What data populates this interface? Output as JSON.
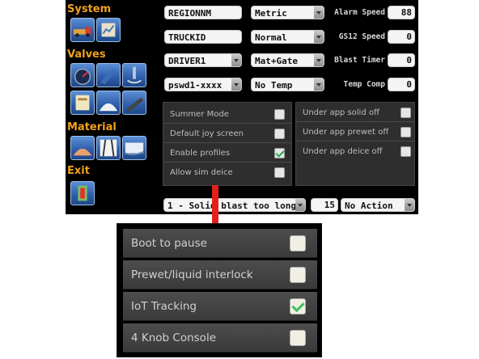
{
  "sidebar": {
    "sections": [
      {
        "title": "System",
        "icons": [
          "truck-icon",
          "settings-chart-icon"
        ]
      },
      {
        "title": "Valves",
        "icons": [
          "gauge-icon",
          "spreader-icon",
          "valve-icon",
          "calibration-icon",
          "pile-icon",
          "blade-icon"
        ]
      },
      {
        "title": "Material",
        "icons": [
          "salt-icon",
          "road-icon",
          "snow-icon"
        ]
      },
      {
        "title": "Exit",
        "icons": [
          "exit-icon"
        ]
      }
    ]
  },
  "fields": {
    "region": "REGIONNM",
    "truck": "TRUCKID",
    "driver": "DRIVER1",
    "password": "pswd1-xxxx"
  },
  "dropdowns": {
    "units": "Metric",
    "mode": "Normal",
    "material": "Mat+Gate",
    "temp": "No Temp"
  },
  "readouts": [
    {
      "label": "Alarm Speed",
      "value": "88"
    },
    {
      "label": "GS12 Speed",
      "value": "0"
    },
    {
      "label": "Blast Timer",
      "value": "0"
    },
    {
      "label": "Temp Comp",
      "value": "0"
    }
  ],
  "left_options": [
    {
      "label": "Summer Mode",
      "checked": false
    },
    {
      "label": "Default joy screen",
      "checked": false
    },
    {
      "label": "Enable profiles",
      "checked": true
    },
    {
      "label": "Allow sim deice",
      "checked": false
    }
  ],
  "right_options": [
    {
      "label": "Under app solid off",
      "checked": false
    },
    {
      "label": "Under app prewet off",
      "checked": false
    },
    {
      "label": "Under app deice off",
      "checked": false
    }
  ],
  "bottom_bar": {
    "alarm_select": "1 - Solid blast too long",
    "alarm_number": "15",
    "action_select": "No Action"
  },
  "zoom_options": [
    {
      "label": "Boot to pause",
      "checked": false
    },
    {
      "label": "Prewet/liquid interlock",
      "checked": false
    },
    {
      "label": "IoT Tracking",
      "checked": true
    },
    {
      "label": "4 Knob Console",
      "checked": false
    }
  ],
  "colors": {
    "section_title": "#f0a21e",
    "arrow": "#e1221b",
    "check": "#2aa84a"
  }
}
